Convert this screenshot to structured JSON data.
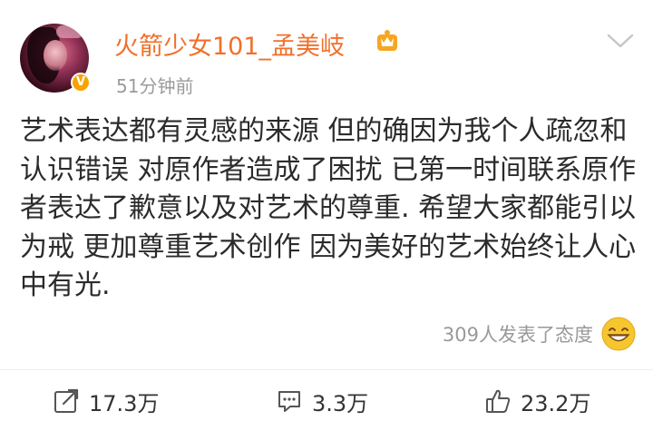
{
  "user": {
    "name": "火箭少女101_孟美岐",
    "timestamp": "51分钟前"
  },
  "post": {
    "text": "艺术表达都有灵感的来源 但的确因为我个人疏忽和认识错误 对原作者造成了困扰 已第一时间联系原作者表达了歉意以及对艺术的尊重. 希望大家都能引以为戒 更加尊重艺术创作 因为美好的艺术始终让人心中有光."
  },
  "reactions": {
    "summary": "309人发表了态度"
  },
  "actions": {
    "repost_count": "17.3万",
    "comment_count": "3.3万",
    "like_count": "23.2万"
  },
  "colors": {
    "username": "#f1702a",
    "verified_badge": "#f7a400",
    "muted_text": "#9b9b9b",
    "body_text": "#2b2b2b"
  },
  "icons": {
    "verified": "verified-v-badge-icon",
    "member": "crown-member-icon",
    "menu": "chevron-down-icon",
    "reaction": "grinning-emoji-icon",
    "repost": "repost-icon",
    "comment": "comment-icon",
    "like": "thumbs-up-icon"
  }
}
